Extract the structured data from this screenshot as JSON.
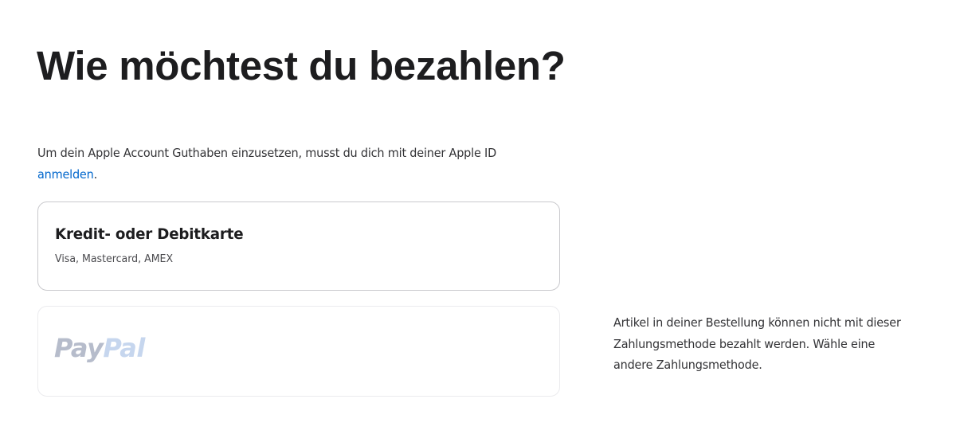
{
  "page": {
    "title": "Wie möchtest du bezahlen?"
  },
  "intro": {
    "text_before_link": "Um dein Apple Account Guthaben einzusetzen, musst du dich mit deiner Apple ID ",
    "link_text": "anmelden",
    "text_after_link": "."
  },
  "payment_options": {
    "card": {
      "title": "Kredit- oder Debitkarte",
      "subtitle": "Visa, Mastercard, AMEX"
    },
    "paypal": {
      "logo_part1": "Pay",
      "logo_part2": "Pal",
      "disabled": true,
      "unavailable_note": "Artikel in deiner Bestellung können nicht mit dieser Zahlungsmethode bezahlt werden. Wähle eine andere Zahlungsmethode."
    }
  },
  "colors": {
    "link": "#0066cc",
    "text": "#1d1d1f",
    "card_border": "#c9c9cd",
    "disabled_border": "#ebebee",
    "paypal_logo_dark": "#b6bccb",
    "paypal_logo_light": "#c6d6ee"
  }
}
